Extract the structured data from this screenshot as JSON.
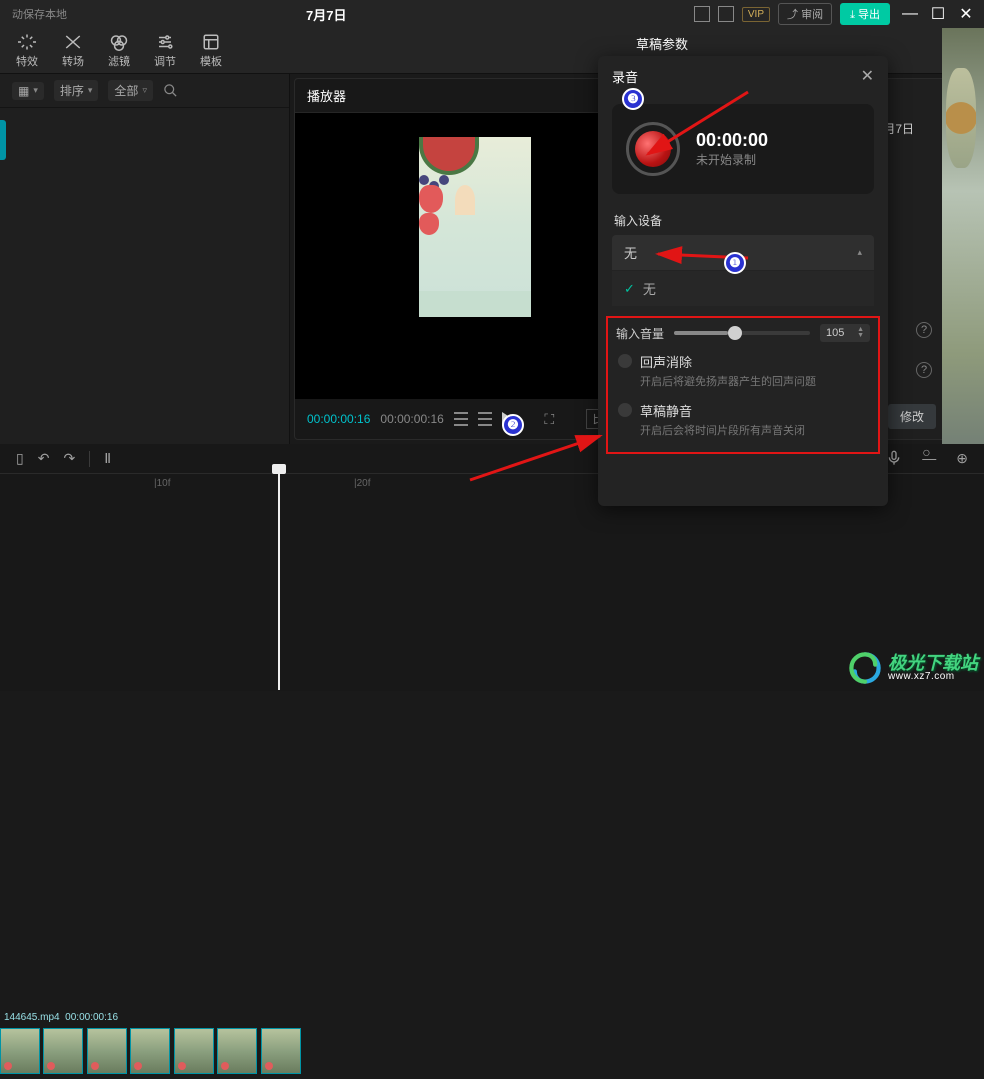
{
  "topbar": {
    "save_status": "动保存本地",
    "project_date": "7月7日",
    "vip": "VIP",
    "review": "⤴ 审阅",
    "export": "⤓ 导出"
  },
  "tools": {
    "effect": "特效",
    "transition": "转场",
    "filter": "滤镜",
    "adjust": "调节",
    "template": "模板"
  },
  "filterbar": {
    "sort": "排序",
    "all": "全部"
  },
  "player": {
    "title": "播放器",
    "tc_current": "00:00:00:16",
    "tc_total": "00:00:00:16",
    "ratio": "比例"
  },
  "draft": {
    "title": "草稿参数",
    "date": "7月7日",
    "modify": "修改"
  },
  "record": {
    "title": "录音",
    "timecode": "00:00:00",
    "status": "未开始录制",
    "input_device": "输入设备",
    "device_value": "无",
    "device_option": "无",
    "volume_label": "输入音量",
    "volume_value": "105",
    "echo_title": "回声消除",
    "echo_desc": "开启后将避免扬声器产生的回声问题",
    "mute_title": "草稿静音",
    "mute_desc": "开启后会将时间片段所有声音关闭"
  },
  "timeline": {
    "mark_10f": "|10f",
    "mark_20f": "|20f",
    "clip_name": "144645.mp4",
    "clip_dur": "00:00:00:16"
  },
  "badges": {
    "b1": "❶",
    "b2": "❷",
    "b3": "❸"
  },
  "watermark": {
    "brand": "极光下载站",
    "url": "www.xz7.com"
  }
}
